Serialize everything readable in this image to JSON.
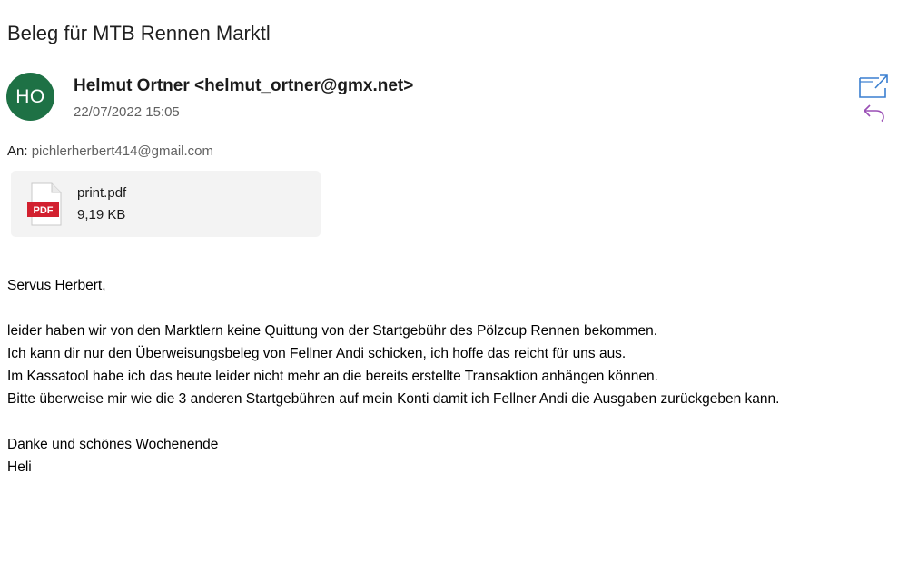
{
  "email": {
    "subject": "Beleg für MTB Rennen Marktl",
    "avatar_initials": "HO",
    "avatar_color": "#1e7145",
    "sender": "Helmut Ortner <helmut_ortner@gmx.net>",
    "date": "22/07/2022 15:05",
    "to_label": "An:",
    "to_value": "pichlerherbert414@gmail.com",
    "accent_color": "#3a7fd0",
    "reply_color": "#9a4fb5"
  },
  "attachment": {
    "icon": "pdf-file-icon",
    "icon_label": "PDF",
    "name": "print.pdf",
    "size": "9,19 KB"
  },
  "body": {
    "greeting": "Servus Herbert,",
    "lines": [
      "leider haben wir von den Marktlern keine Quittung von der Startgebühr des Pölzcup Rennen bekommen.",
      "Ich kann dir nur den Überweisungsbeleg von Fellner Andi schicken, ich hoffe das reicht für uns aus.",
      "Im Kassatool habe ich das heute leider nicht mehr an die bereits erstellte Transaktion anhängen können.",
      "Bitte überweise mir wie die 3 anderen Startgebühren auf mein Konti damit ich Fellner Andi die Ausgaben zurückgeben kann."
    ],
    "closing": "Danke und schönes Wochenende",
    "signature": "Heli"
  },
  "icons": {
    "popout": "open-in-new-window-icon",
    "reply": "reply-icon"
  }
}
